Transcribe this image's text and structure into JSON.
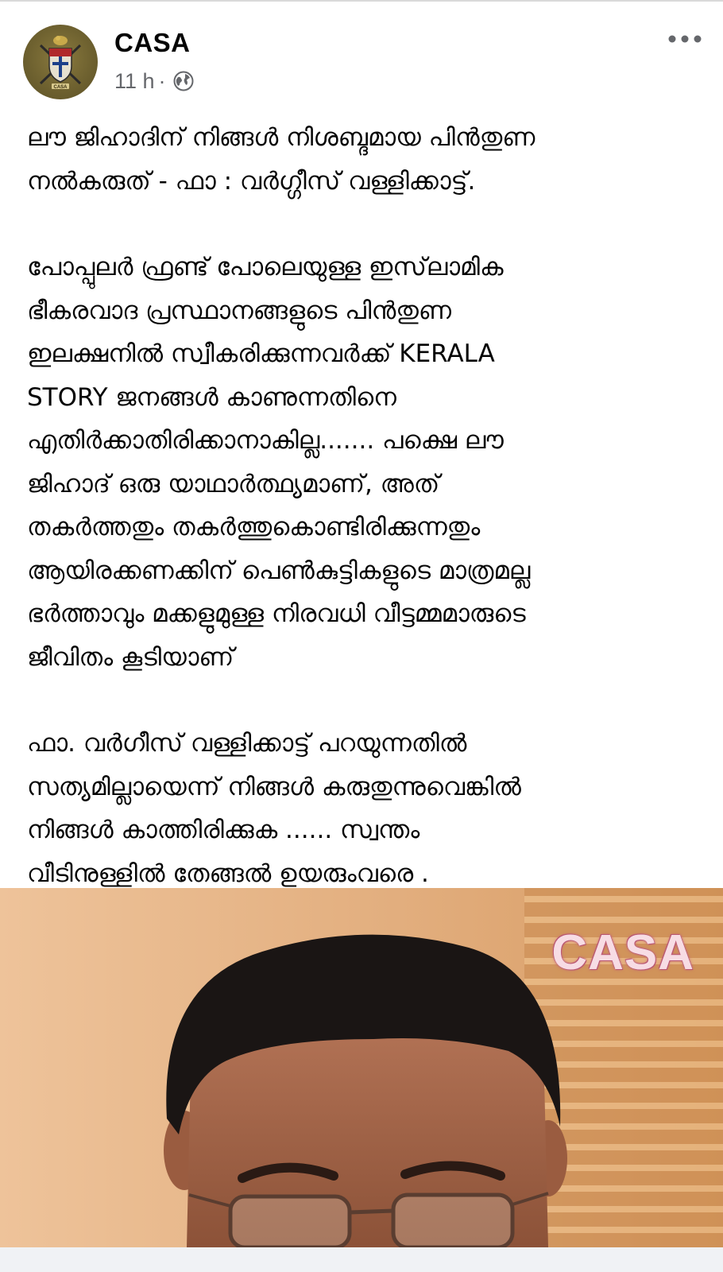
{
  "post": {
    "author_name": "CASA",
    "timestamp": "11 h",
    "separator": "·",
    "privacy_icon": "globe-icon",
    "more_icon": "more-horizontal-icon",
    "paragraphs": [
      "ലൗ ജിഹാദിന് നിങ്ങൾ നിശബ്ദമായ പിൻതുണ\nനൽകരുത് -  ഫാ : വർഗ്ഗീസ് വള്ളിക്കാട്ട്.",
      " പോപ്പുലർ ഫ്രണ്ട് പോലെയുള്ള ഇസ്‌ലാമിക\nഭീകരവാദ പ്രസ്ഥാനങ്ങളുടെ പിൻതുണ\nഇലക്ഷനിൽ  സ്വീകരിക്കുന്നവർക്ക്  KERALA\nSTORY ജനങ്ങൾ കാണുന്നതിനെ\nഎതിർക്കാതിരിക്കാനാകില്ല....... പക്ഷെ ലൗ\nജിഹാദ് ഒരു യാഥാർത്ഥ്യമാണ്, അത്\nതകർത്തതും തകർത്തുകൊണ്ടിരിക്കുന്നതും\nആയിരക്കണക്കിന് പെൺകുട്ടികളുടെ മാത്രമല്ല\nഭർത്താവും മക്കളുമുള്ള നിരവധി വീട്ടമ്മമാരുടെ\nജീവിതം  കൂടിയാണ്",
      "ഫാ. വർഗീസ് വള്ളിക്കാട്ട് പറയുന്നതിൽ\nസത്യമില്ലായെന്ന് നിങ്ങൾ കരുതുന്നുവെങ്കിൽ\nനിങ്ങൾ കാത്തിരിക്കുക ...... സ്വന്തം\nവീടിനുള്ളിൽ തേങ്ങൽ ഉയരുംവരെ ."
    ]
  },
  "image": {
    "watermark": "CASA"
  },
  "colors": {
    "text": "#050505",
    "meta": "#65676b",
    "avatar_bg": "#6f6230",
    "image_bg": "#e9b98c",
    "watermark": "#f7dce4"
  }
}
